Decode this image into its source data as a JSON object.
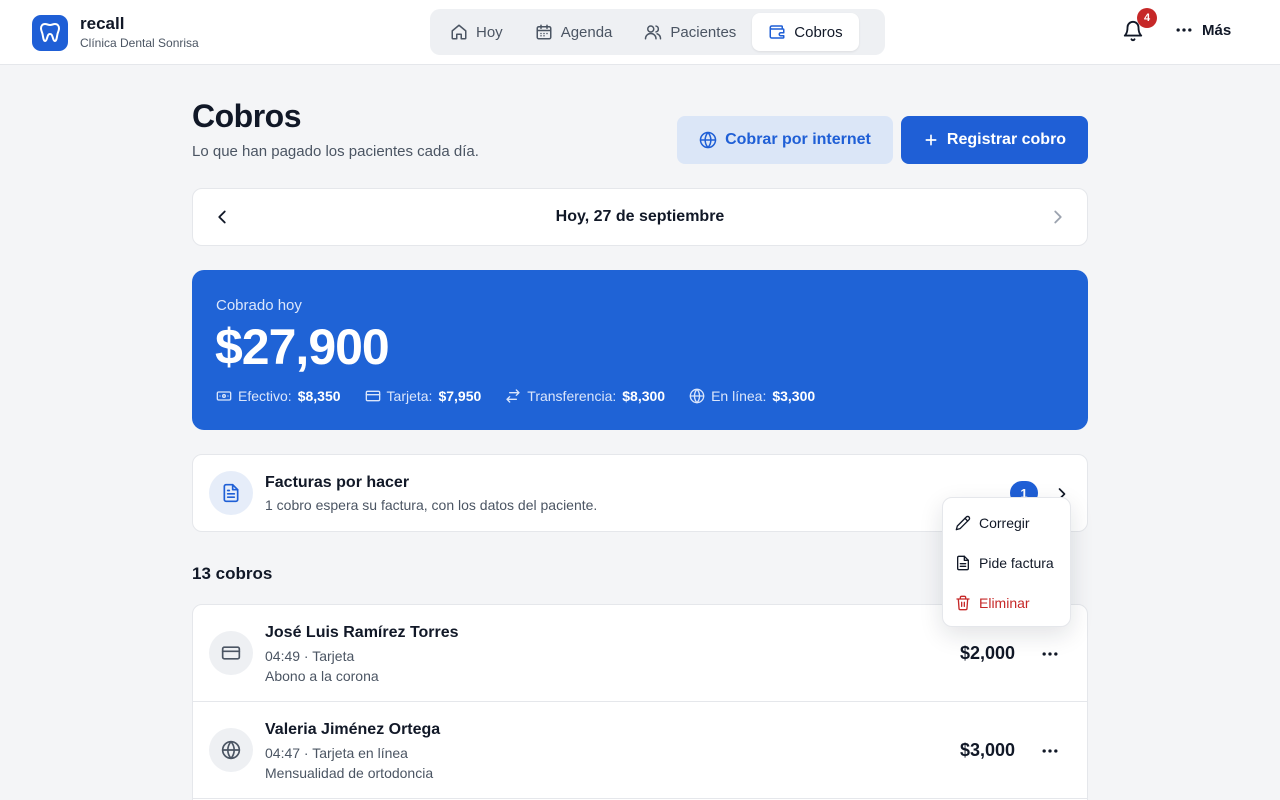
{
  "brand": {
    "name": "recall",
    "subtitle": "Clínica Dental Sonrisa"
  },
  "nav": {
    "items": [
      {
        "label": "Hoy",
        "icon": "home-icon"
      },
      {
        "label": "Agenda",
        "icon": "calendar-icon"
      },
      {
        "label": "Pacientes",
        "icon": "users-icon"
      },
      {
        "label": "Cobros",
        "icon": "wallet-icon",
        "active": true
      }
    ]
  },
  "notifications": {
    "count": "4"
  },
  "more": {
    "label": "Más"
  },
  "header": {
    "title": "Cobros",
    "subtitle": "Lo que han pagado los pacientes cada día.",
    "online_button": "Cobrar por internet",
    "register_button": "Registrar cobro"
  },
  "date_nav": {
    "label": "Hoy, 27 de septiembre"
  },
  "summary": {
    "label": "Cobrado hoy",
    "amount": "$27,900",
    "breakdown": [
      {
        "label": "Efectivo:",
        "value": "$8,350",
        "icon": "cash-icon"
      },
      {
        "label": "Tarjeta:",
        "value": "$7,950",
        "icon": "card-icon"
      },
      {
        "label": "Transferencia:",
        "value": "$8,300",
        "icon": "transfer-icon"
      },
      {
        "label": "En línea:",
        "value": "$3,300",
        "icon": "globe-icon"
      }
    ]
  },
  "invoices": {
    "title": "Facturas por hacer",
    "subtitle": "1 cobro espera su factura, con los datos del paciente.",
    "badge": "1"
  },
  "payments": {
    "count_label": "13 cobros",
    "filter_hint": "",
    "rows": [
      {
        "name": "José Luis Ramírez Torres",
        "meta": "04:49 · Tarjeta",
        "note": "Abono a la corona",
        "amount": "$2,000",
        "icon": "card-icon"
      },
      {
        "name": "Valeria Jiménez Ortega",
        "meta": "04:47 · Tarjeta en línea",
        "note": "Mensualidad de ortodoncia",
        "amount": "$3,000",
        "icon": "globe-icon"
      }
    ]
  },
  "context_menu": {
    "items": [
      {
        "label": "Corregir",
        "icon": "pencil-icon"
      },
      {
        "label": "Pide factura",
        "icon": "document-icon"
      },
      {
        "label": "Eliminar",
        "icon": "trash-icon",
        "danger": true
      }
    ]
  },
  "colors": {
    "accent": "#1f5fd6",
    "danger": "#c62828",
    "background": "#f4f5f7"
  }
}
